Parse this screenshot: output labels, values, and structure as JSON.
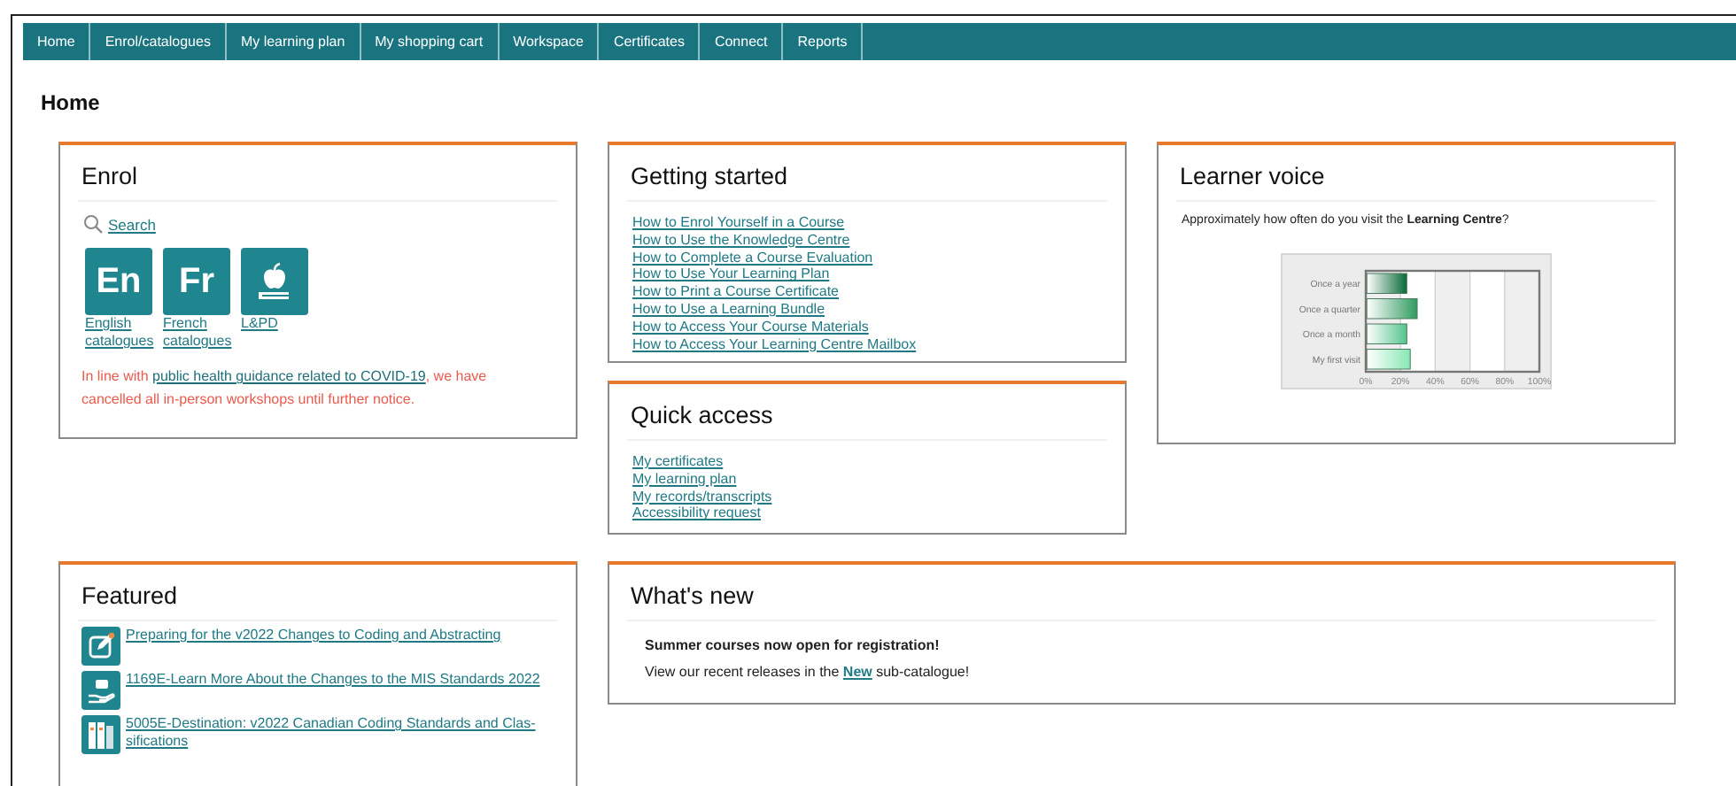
{
  "nav": [
    {
      "label": "Home"
    },
    {
      "label": "Enrol/catalogues"
    },
    {
      "label": "My learning plan"
    },
    {
      "label": "My shopping cart"
    },
    {
      "label": "Workspace"
    },
    {
      "label": "Certificates"
    },
    {
      "label": "Connect"
    },
    {
      "label": "Reports"
    }
  ],
  "page_title": "Home",
  "enrol": {
    "title": "Enrol",
    "search": "Search",
    "catalogues": [
      {
        "kind": "text",
        "tile": "En",
        "label": "English catalogues"
      },
      {
        "kind": "text",
        "tile": "Fr",
        "label": "French catalogues"
      },
      {
        "kind": "icon",
        "label": "L&PD"
      }
    ],
    "notice": {
      "before": "In line with ",
      "link": "public health guidance related to COVID-19",
      "after": ", we have cancelled all in-person workshops until further notice."
    }
  },
  "getting_started": {
    "title": "Getting started",
    "links": [
      "How to Enrol Yourself in a Course",
      "How to Use the Knowledge Centre",
      "How to Complete a Course Evaluation",
      "How to Use Your Learning Plan",
      "How to Print a Course Certificate",
      "How to Use a Learning Bundle",
      "How to Access Your Course Materials",
      "How to Access Your Learning Centre Mailbox"
    ]
  },
  "quick_access": {
    "title": "Quick access",
    "links": [
      "My certificates",
      "My learning plan",
      "My records/transcripts",
      "Accessibility request"
    ]
  },
  "learner_voice": {
    "title": "Learner voice",
    "question": "Approximately how often do you visit the **Learning Centre**?",
    "chart_data": {
      "type": "bar",
      "orientation": "horizontal",
      "grid": true,
      "categories": [
        "Once a year",
        "Once a quarter",
        "Once a month",
        "My first visit"
      ],
      "values": [
        23,
        29,
        23,
        25
      ],
      "xlim": [
        0,
        100
      ],
      "xticks": [
        {
          "value": 0,
          "label": "0%"
        },
        {
          "value": 20,
          "label": "20%"
        },
        {
          "value": 40,
          "label": "40%"
        },
        {
          "value": 60,
          "label": "60%"
        },
        {
          "value": 80,
          "label": "80%"
        },
        {
          "value": 100,
          "label": "100%"
        }
      ]
    }
  },
  "featured": {
    "title": "Featured",
    "items": [
      {
        "kind": "pencil",
        "label": "Preparing for the v2022 Changes to Coding and Abstracting"
      },
      {
        "kind": "hand",
        "label": "1169E-Learn More About the Changes to the MIS Standards 2022"
      },
      {
        "kind": "books",
        "label": "5005E-Destination: v2022 Canadian Coding Standards and Clas-sifications"
      }
    ]
  },
  "whats_new": {
    "title": "What's new",
    "headline": "Summer courses now open for registration!",
    "text_before": "View our recent releases in the ",
    "link": "New",
    "text_after": " sub-catalogue!"
  }
}
